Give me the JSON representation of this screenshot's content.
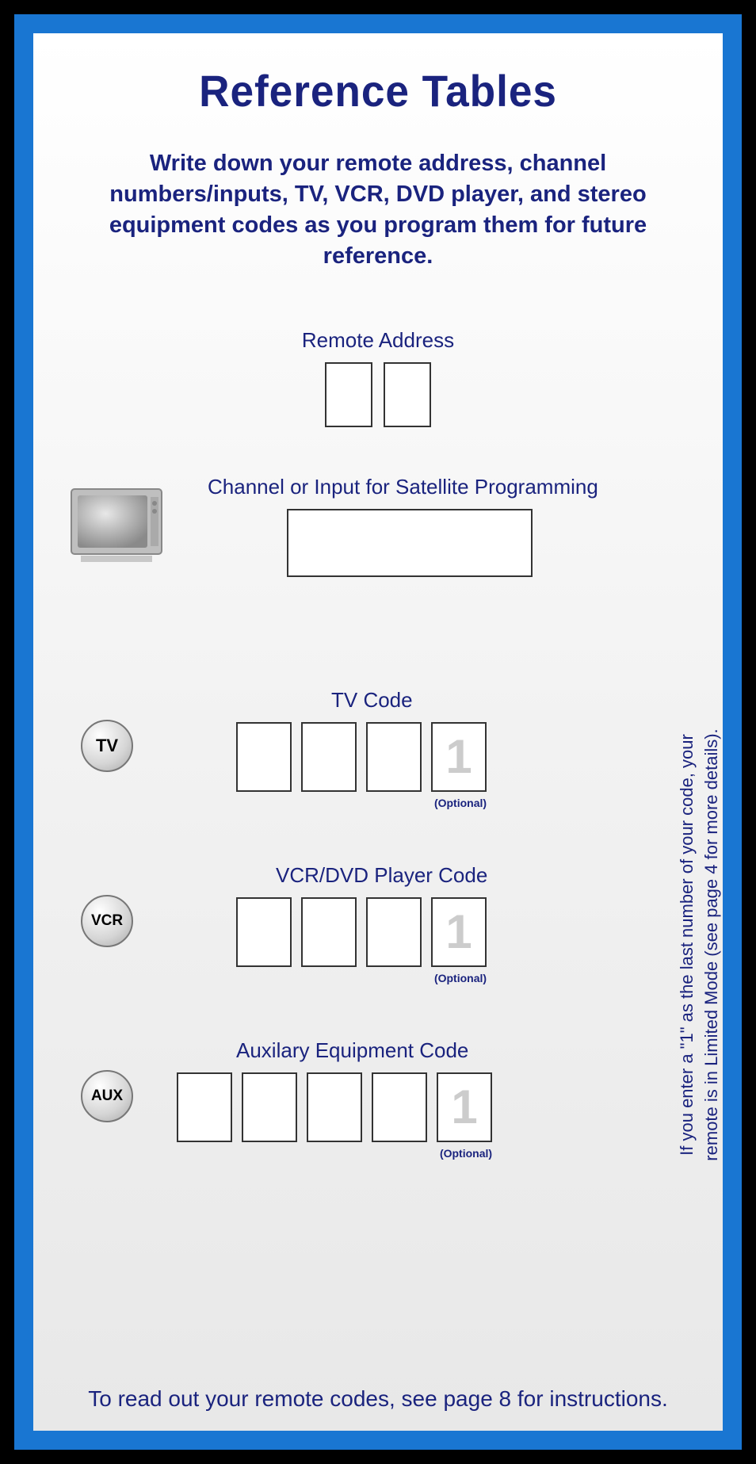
{
  "title": "Reference Tables",
  "subtitle": "Write down your remote address, channel numbers/inputs, TV, VCR, DVD player, and stereo equipment codes as you program them for future reference.",
  "remote_address_label": "Remote Address",
  "channel_label": "Channel or Input for Satellite Programming",
  "tv": {
    "button": "TV",
    "label": "TV Code",
    "optional_digit": "1",
    "optional_text": "(Optional)"
  },
  "vcr": {
    "button": "VCR",
    "label": "VCR/DVD Player Code",
    "optional_digit": "1",
    "optional_text": "(Optional)"
  },
  "aux": {
    "button": "AUX",
    "label": "Auxilary Equipment Code",
    "optional_digit": "1",
    "optional_text": "(Optional)"
  },
  "side_note": "If you enter a \"1\" as the last number of your code, your remote is in Limited Mode (see page 4 for more details).",
  "footer": "To read out your remote codes, see page 8 for instructions."
}
